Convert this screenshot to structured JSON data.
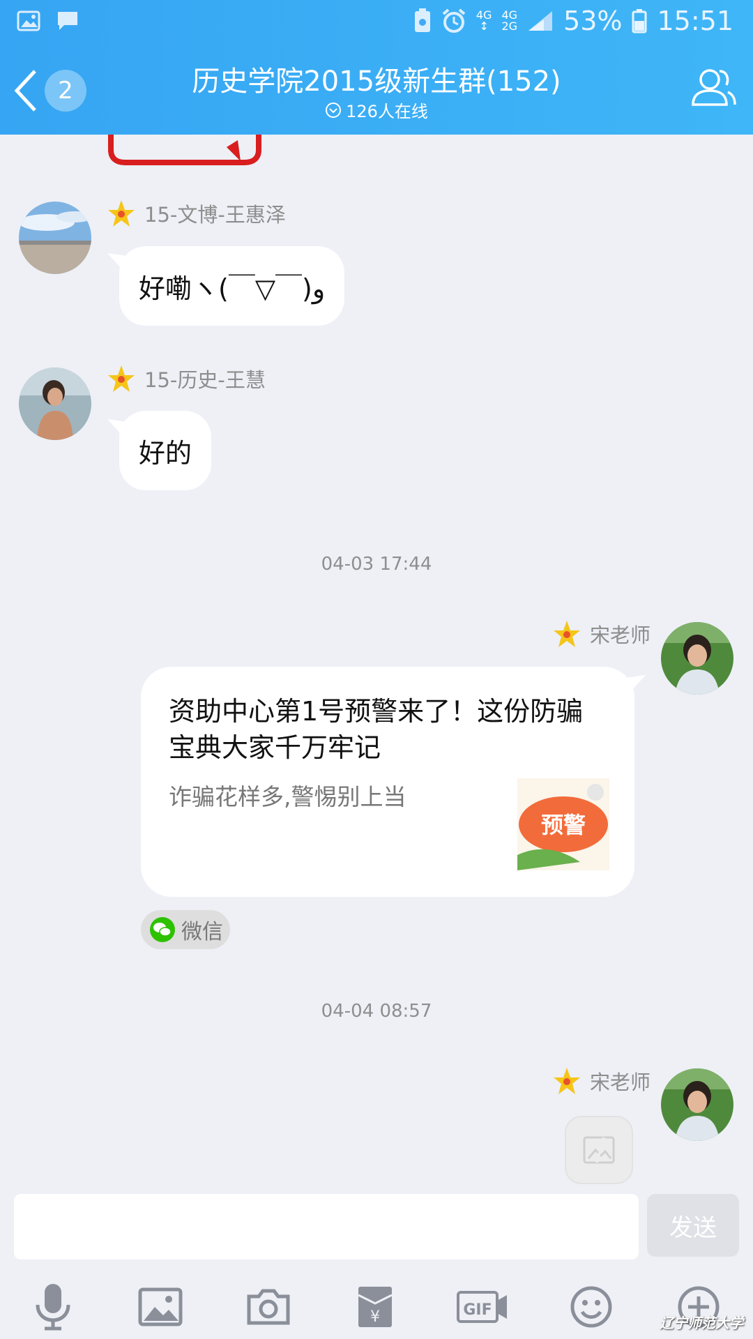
{
  "statusbar": {
    "network_a": "4G",
    "network_b_top": "4G",
    "network_b_bottom": "2G",
    "battery": "53%",
    "time": "15:51"
  },
  "header": {
    "back_badge": "2",
    "title": "历史学院2015级新生群(152)",
    "online": "126人在线"
  },
  "messages": [
    {
      "sender": "15-文博-王惠泽",
      "text": "好嘞ヽ(￣▽￣)و"
    },
    {
      "sender": "15-历史-王慧",
      "text": "好的"
    }
  ],
  "timestamps": [
    "04-03 17:44",
    "04-04 08:57"
  ],
  "card": {
    "sender": "宋老师",
    "title": "资助中心第1号预警来了！这份防骗宝典大家千万牢记",
    "desc": "诈骗花样多,警惕别上当",
    "thumb_text": "预警",
    "source": "微信"
  },
  "last_sender": "宋老师",
  "input": {
    "placeholder": "",
    "send_label": "发送"
  },
  "watermark": "辽宁师范大学",
  "colors": {
    "header": "#36a5f3",
    "bubble": "#ffffff",
    "background": "#eef0f6",
    "star": "#f5c518"
  }
}
